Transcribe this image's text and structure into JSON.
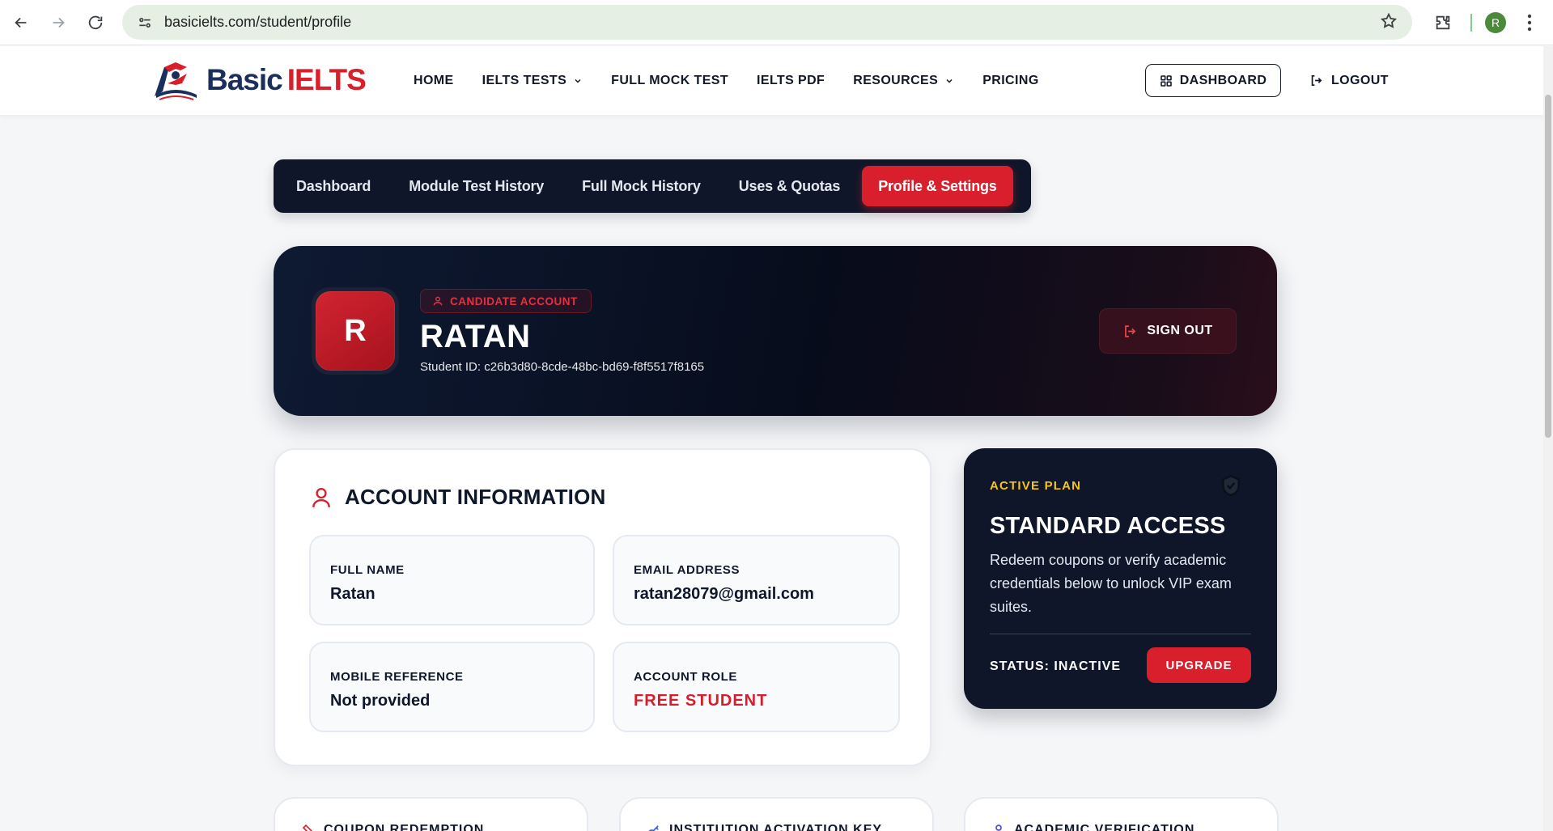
{
  "browser": {
    "url": "basicielts.com/student/profile",
    "profile_initial": "R"
  },
  "header": {
    "logo": {
      "basic": "Basic",
      "ielts": "IELTS"
    },
    "nav": [
      "HOME",
      "IELTS TESTS",
      "FULL MOCK TEST",
      "IELTS PDF",
      "RESOURCES",
      "PRICING"
    ],
    "dashboard_label": "DASHBOARD",
    "logout_label": "LOGOUT"
  },
  "tabs": [
    {
      "label": "Dashboard",
      "active": false
    },
    {
      "label": "Module Test History",
      "active": false
    },
    {
      "label": "Full Mock History",
      "active": false
    },
    {
      "label": "Uses & Quotas",
      "active": false
    },
    {
      "label": "Profile & Settings",
      "active": true
    }
  ],
  "hero": {
    "avatar_initial": "R",
    "badge": "CANDIDATE ACCOUNT",
    "name": "RATAN",
    "student_id": "Student ID: c26b3d80-8cde-48bc-bd69-f8f5517f8165",
    "signout_label": "SIGN OUT"
  },
  "account": {
    "title": "ACCOUNT INFORMATION",
    "fields": [
      {
        "label": "FULL NAME",
        "value": "Ratan"
      },
      {
        "label": "EMAIL ADDRESS",
        "value": "ratan28079@gmail.com"
      },
      {
        "label": "MOBILE REFERENCE",
        "value": "Not provided"
      },
      {
        "label": "ACCOUNT ROLE",
        "value": "FREE STUDENT"
      }
    ]
  },
  "plan": {
    "label": "ACTIVE PLAN",
    "title": "STANDARD ACCESS",
    "description": "Redeem coupons or verify academic credentials below to unlock VIP exam suites.",
    "status": "STATUS: INACTIVE",
    "upgrade_label": "UPGRADE"
  },
  "bottom_cards": [
    {
      "title": "COUPON REDEMPTION"
    },
    {
      "title": "INSTITUTION ACTIVATION KEY"
    },
    {
      "title": "ACADEMIC VERIFICATION"
    }
  ],
  "colors": {
    "brand_red": "#d91e2c",
    "navy": "#0f1629",
    "plan_accent": "#f5c518"
  }
}
